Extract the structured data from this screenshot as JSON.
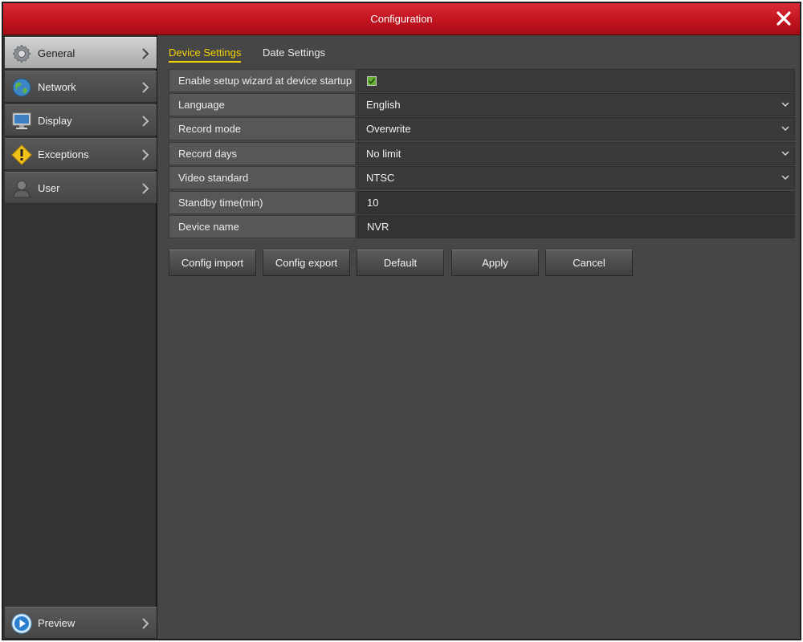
{
  "window": {
    "title": "Configuration"
  },
  "sidebar": {
    "items": [
      {
        "label": "General",
        "icon": "gear-icon",
        "active": true
      },
      {
        "label": "Network",
        "icon": "globe-icon"
      },
      {
        "label": "Display",
        "icon": "monitor-icon"
      },
      {
        "label": "Exceptions",
        "icon": "warning-icon"
      },
      {
        "label": "User",
        "icon": "user-icon"
      }
    ],
    "footer": {
      "label": "Preview",
      "icon": "play-icon"
    }
  },
  "tabs": [
    {
      "label": "Device Settings",
      "active": true
    },
    {
      "label": "Date Settings"
    }
  ],
  "form": {
    "setup_wizard": {
      "label": "Enable setup wizard at device startup",
      "checked": true
    },
    "language": {
      "label": "Language",
      "value": "English"
    },
    "record_mode": {
      "label": "Record mode",
      "value": "Overwrite"
    },
    "record_days": {
      "label": "Record days",
      "value": "No limit"
    },
    "video_standard": {
      "label": "Video standard",
      "value": "NTSC"
    },
    "standby_time": {
      "label": "Standby time(min)",
      "value": "10"
    },
    "device_name": {
      "label": "Device name",
      "value": "NVR"
    }
  },
  "buttons": {
    "config_import": "Config import",
    "config_export": "Config export",
    "default": "Default",
    "apply": "Apply",
    "cancel": "Cancel"
  },
  "colors": {
    "titlebar": "#c2141f",
    "active_tab": "#f2d200",
    "checkbox": "#66b033",
    "background": "#464646"
  }
}
